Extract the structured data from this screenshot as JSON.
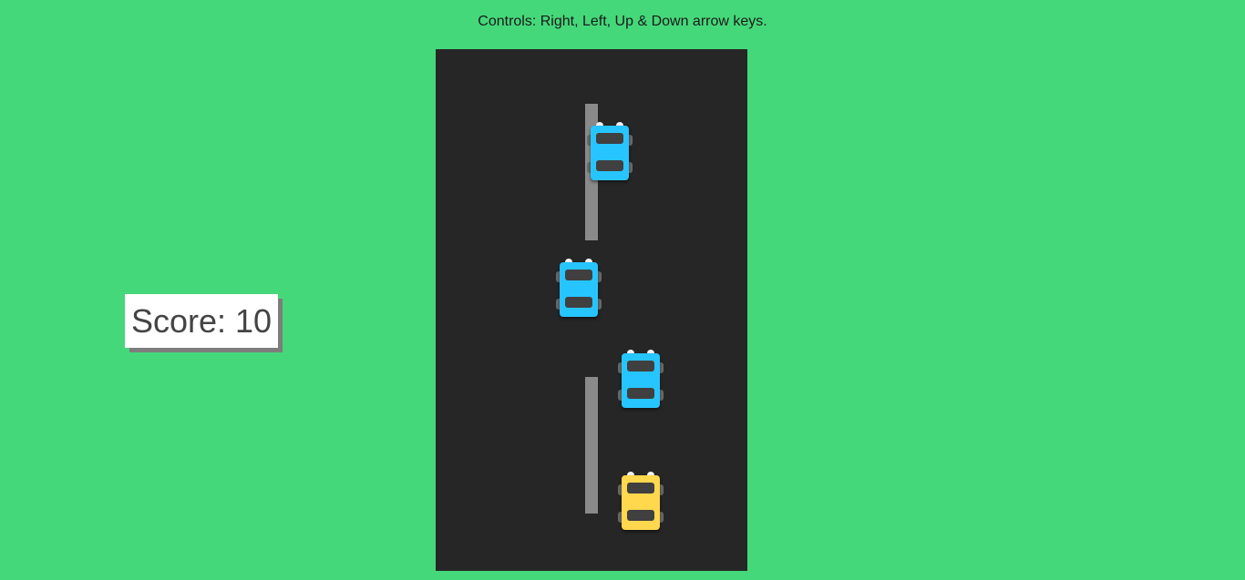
{
  "header": {
    "controls_text": "Controls: Right, Left, Up & Down arrow keys."
  },
  "score": {
    "text": "Score: 10",
    "value": 10
  },
  "colors": {
    "background": "#45d87a",
    "road": "#262626",
    "lane_line": "#8a8a8a",
    "enemy_car": "#27c5ff",
    "player_car": "#ffd84d"
  }
}
